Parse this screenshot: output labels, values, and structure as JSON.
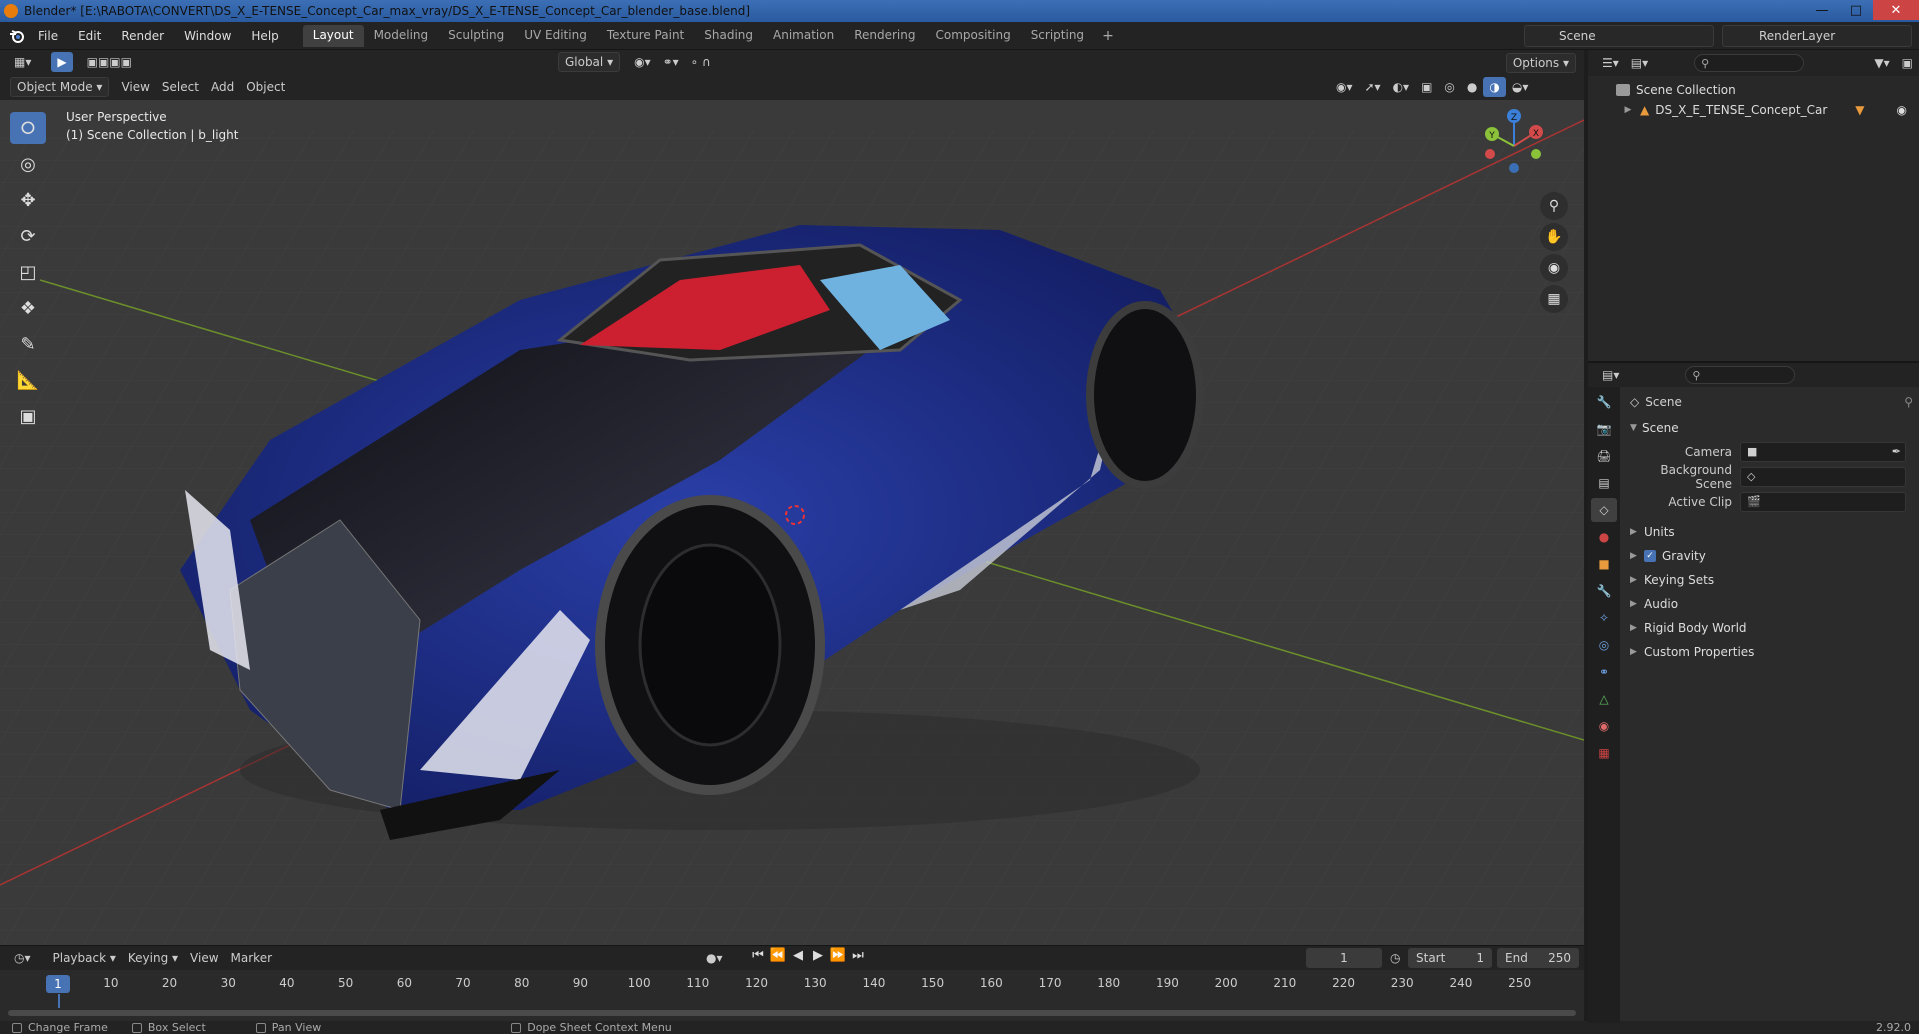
{
  "titlebar": {
    "text": "Blender* [E:\\RABOTA\\CONVERT\\DS_X_E-TENSE_Concept_Car_max_vray/DS_X_E-TENSE_Concept_Car_blender_base.blend]"
  },
  "menu": [
    "File",
    "Edit",
    "Render",
    "Window",
    "Help"
  ],
  "workspaces": [
    "Layout",
    "Modeling",
    "Sculpting",
    "UV Editing",
    "Texture Paint",
    "Shading",
    "Animation",
    "Rendering",
    "Compositing",
    "Scripting"
  ],
  "active_workspace": "Layout",
  "scene_name": "Scene",
  "render_layer": "RenderLayer",
  "viewport": {
    "mode": "Object Mode",
    "menus": [
      "View",
      "Select",
      "Add",
      "Object"
    ],
    "transform_orientation": "Global",
    "options_label": "Options",
    "info_line1": "User Perspective",
    "info_line2": "(1) Scene Collection | b_light",
    "gizmo_axes": {
      "x": "X",
      "y": "Y",
      "z": "Z"
    }
  },
  "timeline": {
    "menus": [
      "Playback",
      "Keying",
      "View",
      "Marker"
    ],
    "current_frame": "1",
    "start_label": "Start",
    "start_value": "1",
    "end_label": "End",
    "end_value": "250",
    "ticks": [
      "10",
      "20",
      "30",
      "40",
      "50",
      "60",
      "70",
      "80",
      "90",
      "100",
      "110",
      "120",
      "130",
      "140",
      "150",
      "160",
      "170",
      "180",
      "190",
      "200",
      "210",
      "220",
      "230",
      "240",
      "250"
    ],
    "cursor_frame": "1"
  },
  "statusbar": {
    "items": [
      "Change Frame",
      "Box Select",
      "Pan View",
      "Dope Sheet Context Menu"
    ],
    "version": "2.92.0"
  },
  "outliner": {
    "root": "Scene Collection",
    "children": [
      "DS_X_E_TENSE_Concept_Car"
    ]
  },
  "properties": {
    "context_title": "Scene",
    "panel_title": "Scene",
    "fields": [
      {
        "label": "Camera",
        "value": ""
      },
      {
        "label": "Background Scene",
        "value": ""
      },
      {
        "label": "Active Clip",
        "value": ""
      }
    ],
    "subpanels": [
      {
        "label": "Units",
        "checkbox": false
      },
      {
        "label": "Gravity",
        "checkbox": true
      },
      {
        "label": "Keying Sets",
        "checkbox": false
      },
      {
        "label": "Audio",
        "checkbox": false
      },
      {
        "label": "Rigid Body World",
        "checkbox": false
      },
      {
        "label": "Custom Properties",
        "checkbox": false
      }
    ]
  },
  "colors": {
    "accent": "#4772b3",
    "car_body": "#1f2f8a",
    "interior_red": "#cc2030"
  }
}
